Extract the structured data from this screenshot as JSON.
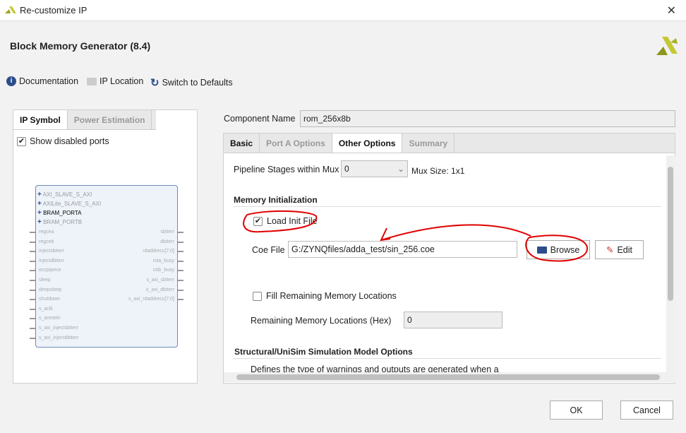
{
  "window": {
    "title": "Re-customize IP"
  },
  "header": {
    "title": "Block Memory Generator (8.4)"
  },
  "toolbar": {
    "documentation": "Documentation",
    "ip_location": "IP Location",
    "switch_defaults": "Switch to Defaults"
  },
  "left": {
    "tabs": [
      "IP Symbol",
      "Power Estimation"
    ],
    "show_disabled_ports": "Show disabled ports",
    "show_disabled_checked": true,
    "bus_ports": [
      "AXI_SLAVE_S_AXI",
      "AXILite_SLAVE_S_AXI",
      "BRAM_PORTA",
      "BRAM_PORTB"
    ],
    "left_ports": [
      "regcea",
      "regceb",
      "injectsbiterr",
      "injectdbiterr",
      "eccpipece",
      "sleep",
      "deepsleep",
      "shutdown",
      "s_aclk",
      "s_aresetn",
      "s_axi_injectsbiterr",
      "s_axi_injectdbiterr"
    ],
    "right_ports": [
      "sbiterr",
      "dbiterr",
      "rdaddrecc[7:0]",
      "rsta_busy",
      "rstb_busy",
      "s_axi_sbiterr",
      "s_axi_dbiterr",
      "s_axi_rdaddrecc[7:0]"
    ]
  },
  "component": {
    "label": "Component Name",
    "value": "rom_256x8b"
  },
  "tabs": [
    "Basic",
    "Port A Options",
    "Other Options",
    "Summary"
  ],
  "other": {
    "pipeline_label": "Pipeline Stages within Mux",
    "pipeline_value": "0",
    "mux_size": "Mux Size: 1x1",
    "mem_init_title": "Memory Initialization",
    "load_init": "Load Init File",
    "load_init_checked": true,
    "coe_label": "Coe File",
    "coe_value": "G:/ZYNQfiles/adda_test/sin_256.coe",
    "browse": "Browse",
    "edit": "Edit",
    "fill_remaining": "Fill Remaining Memory Locations",
    "fill_checked": false,
    "remaining_label": "Remaining Memory Locations (Hex)",
    "remaining_value": "0",
    "sim_title": "Structural/UniSim Simulation Model Options",
    "sim_desc": "Defines the type of warnings and outputs are generated when a"
  },
  "footer": {
    "ok": "OK",
    "cancel": "Cancel"
  },
  "colors": {
    "annotation": "#e00000",
    "accent": "#2b4d8c"
  }
}
